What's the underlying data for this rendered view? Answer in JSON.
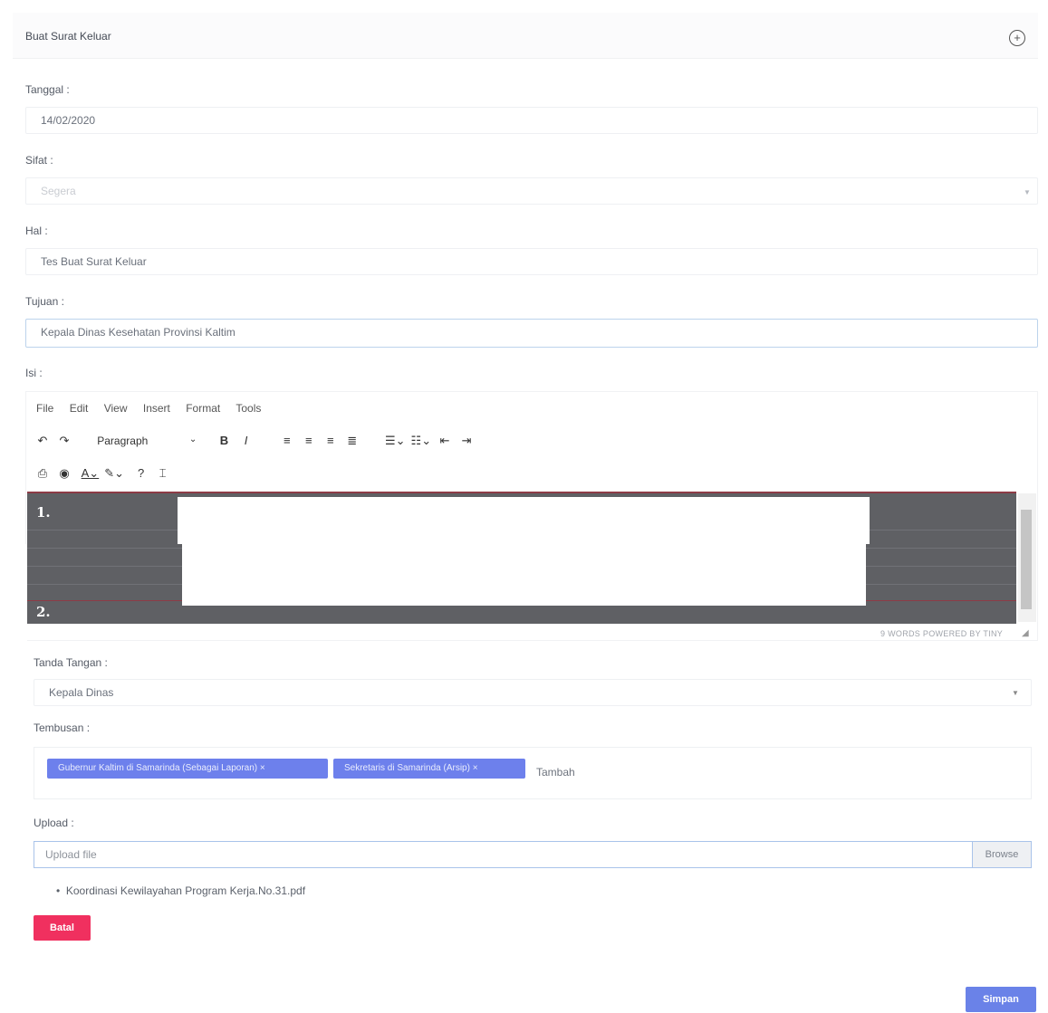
{
  "card": {
    "title": "Buat Surat Keluar"
  },
  "form": {
    "tanggal": {
      "label": "Tanggal :",
      "value": "14/02/2020"
    },
    "sifat": {
      "label": "Sifat :",
      "placeholder": "Segera"
    },
    "hal": {
      "label": "Hal :",
      "value": "Tes Buat Surat Keluar"
    },
    "tujuan": {
      "label": "Tujuan :",
      "value": "Kepala Dinas Kesehatan Provinsi Kaltim"
    },
    "isi": {
      "label": "Isi :"
    },
    "tanda_tangan": {
      "label": "Tanda Tangan :",
      "value": "Kepala Dinas"
    },
    "tembusan": {
      "label": "Tembusan :",
      "tags": [
        "Gubernur Kaltim di Samarinda (Sebagai Laporan)",
        "Sekretaris di Samarinda (Arsip)"
      ],
      "placeholder": "Tambah"
    },
    "upload": {
      "label": "Upload :",
      "placeholder": "Upload file",
      "browse_label": "Browse",
      "files": [
        "Koordinasi Kewilayahan Program Kerja.No.31.pdf"
      ]
    }
  },
  "editor": {
    "menu": [
      "File",
      "Edit",
      "View",
      "Insert",
      "Format",
      "Tools"
    ],
    "block_format": "Paragraph",
    "bold_label": "B",
    "italic_label": "I",
    "content_markers": [
      "1.",
      "2."
    ],
    "status": "9 WORDS  POWERED BY TINY"
  },
  "actions": {
    "batal": "Batal",
    "simpan": "Simpan"
  },
  "colors": {
    "primary": "#6a82e8",
    "danger": "#f0305f",
    "editor_bg": "#5f6064"
  }
}
